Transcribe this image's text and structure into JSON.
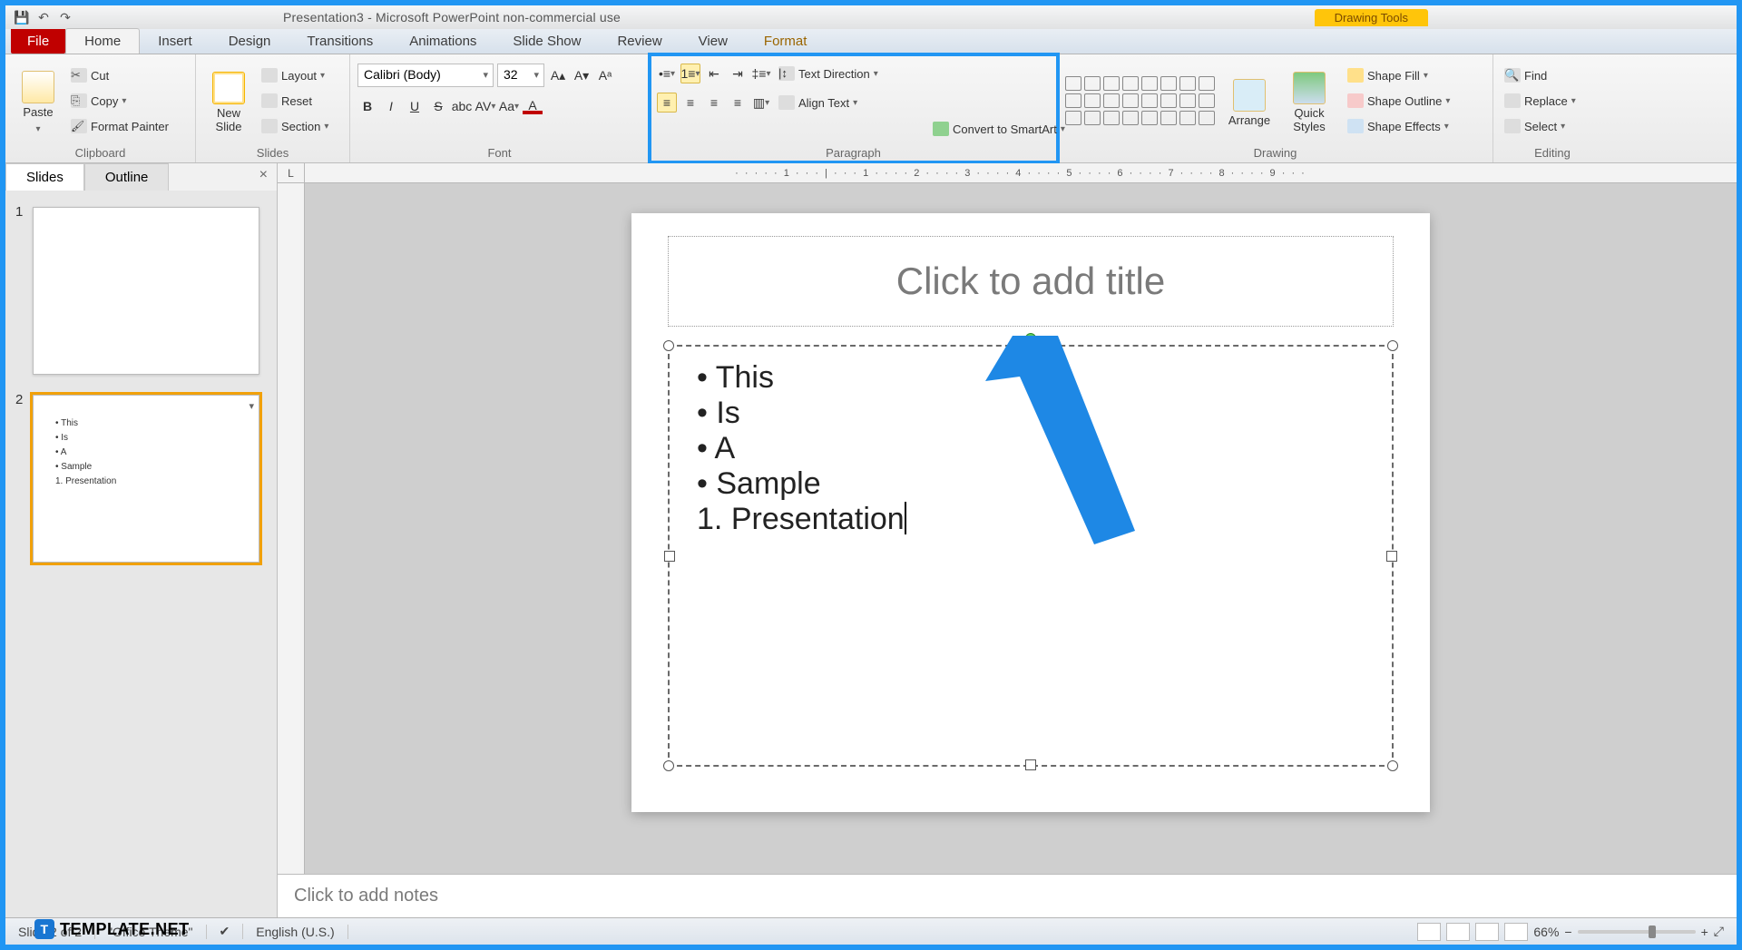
{
  "window": {
    "title": "Presentation3 - Microsoft PowerPoint non-commercial use",
    "context_tab": "Drawing Tools"
  },
  "tabs": {
    "file": "File",
    "list": [
      "Home",
      "Insert",
      "Design",
      "Transitions",
      "Animations",
      "Slide Show",
      "Review",
      "View"
    ],
    "format": "Format",
    "active": "Home"
  },
  "ribbon": {
    "clipboard": {
      "label": "Clipboard",
      "paste": "Paste",
      "cut": "Cut",
      "copy": "Copy",
      "format_painter": "Format Painter"
    },
    "slides": {
      "label": "Slides",
      "new_slide": "New\nSlide",
      "layout": "Layout",
      "reset": "Reset",
      "section": "Section"
    },
    "font": {
      "label": "Font",
      "name": "Calibri (Body)",
      "size": "32"
    },
    "paragraph": {
      "label": "Paragraph",
      "text_direction": "Text Direction",
      "align_text": "Align Text",
      "convert_smartart": "Convert to SmartArt"
    },
    "drawing": {
      "label": "Drawing",
      "arrange": "Arrange",
      "quick_styles": "Quick\nStyles",
      "shape_fill": "Shape Fill",
      "shape_outline": "Shape Outline",
      "shape_effects": "Shape Effects"
    },
    "editing": {
      "label": "Editing",
      "find": "Find",
      "replace": "Replace",
      "select": "Select"
    }
  },
  "side": {
    "slides_tab": "Slides",
    "outline_tab": "Outline",
    "thumb2_lines": [
      "This",
      "Is",
      "A",
      "Sample",
      "1.  Presentation"
    ]
  },
  "slide": {
    "title_placeholder": "Click to add title",
    "bullets": [
      "This",
      "Is",
      "A",
      "Sample"
    ],
    "numbered": [
      "Presentation"
    ]
  },
  "notes": {
    "placeholder": "Click to add notes"
  },
  "status": {
    "slide_of": "Slide 2 of 2",
    "theme": "\"Office Theme\"",
    "lang": "English (U.S.)",
    "zoom": "66%"
  },
  "ruler": {
    "marks": "· · · · · 1 · · · | · · · 1 · · · · 2 · · · · 3 · · · · 4 · · · · 5 · · · · 6 · · · · 7 · · · · 8 · · · · 9 · · ·"
  },
  "watermark": {
    "text": "TEMPLATE.NET"
  }
}
